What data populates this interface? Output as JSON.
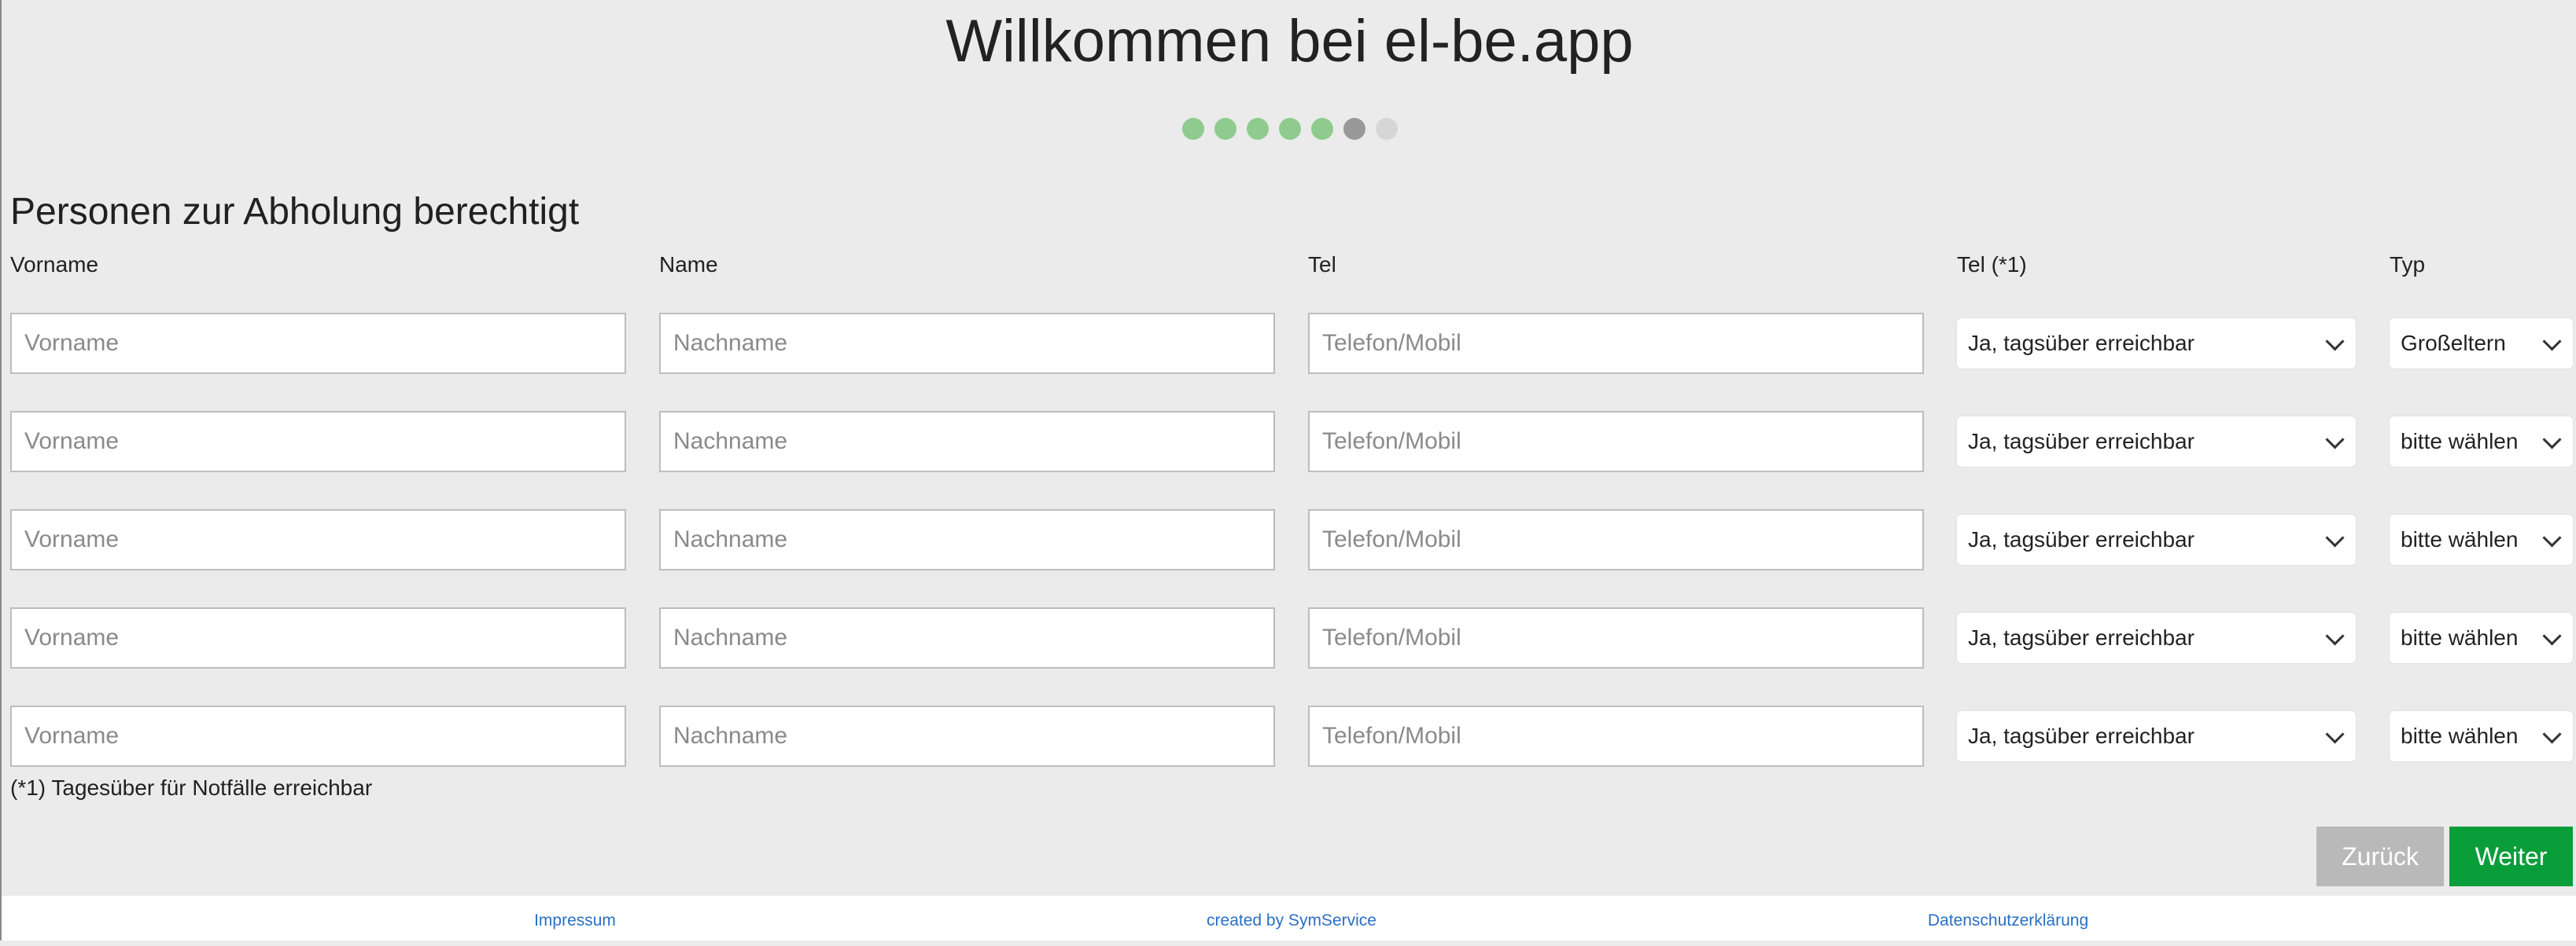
{
  "header": {
    "title": "Willkommen bei el-be.app",
    "steps": [
      "done",
      "done",
      "done",
      "done",
      "done",
      "current",
      "todo"
    ]
  },
  "section": {
    "title": "Personen zur Abholung berechtigt"
  },
  "columns": {
    "vorname": "Vorname",
    "name": "Name",
    "tel": "Tel",
    "tel_reach": "Tel (*1)",
    "typ": "Typ"
  },
  "placeholders": {
    "vorname": "Vorname",
    "nachname": "Nachname",
    "telefon": "Telefon/Mobil"
  },
  "rows": [
    {
      "vorname": "",
      "nachname": "",
      "telefon": "",
      "erreichbar": "Ja, tagsüber erreichbar",
      "typ": "Großeltern"
    },
    {
      "vorname": "",
      "nachname": "",
      "telefon": "",
      "erreichbar": "Ja, tagsüber erreichbar",
      "typ": "bitte wählen"
    },
    {
      "vorname": "",
      "nachname": "",
      "telefon": "",
      "erreichbar": "Ja, tagsüber erreichbar",
      "typ": "bitte wählen"
    },
    {
      "vorname": "",
      "nachname": "",
      "telefon": "",
      "erreichbar": "Ja, tagsüber erreichbar",
      "typ": "bitte wählen"
    },
    {
      "vorname": "",
      "nachname": "",
      "telefon": "",
      "erreichbar": "Ja, tagsüber erreichbar",
      "typ": "bitte wählen"
    }
  ],
  "footnote": "(*1) Tagesüber für Notfälle erreichbar",
  "buttons": {
    "back": "Zurück",
    "next": "Weiter"
  },
  "footer": {
    "impressum": "Impressum",
    "created_by": "created by SymService",
    "datenschutz": "Datenschutzerklärung"
  },
  "colors": {
    "accent": "#0a9e3a",
    "step_done": "#8fcb8f",
    "step_current": "#999999",
    "step_todo": "#d6d6d6",
    "link": "#2a6fc4"
  }
}
